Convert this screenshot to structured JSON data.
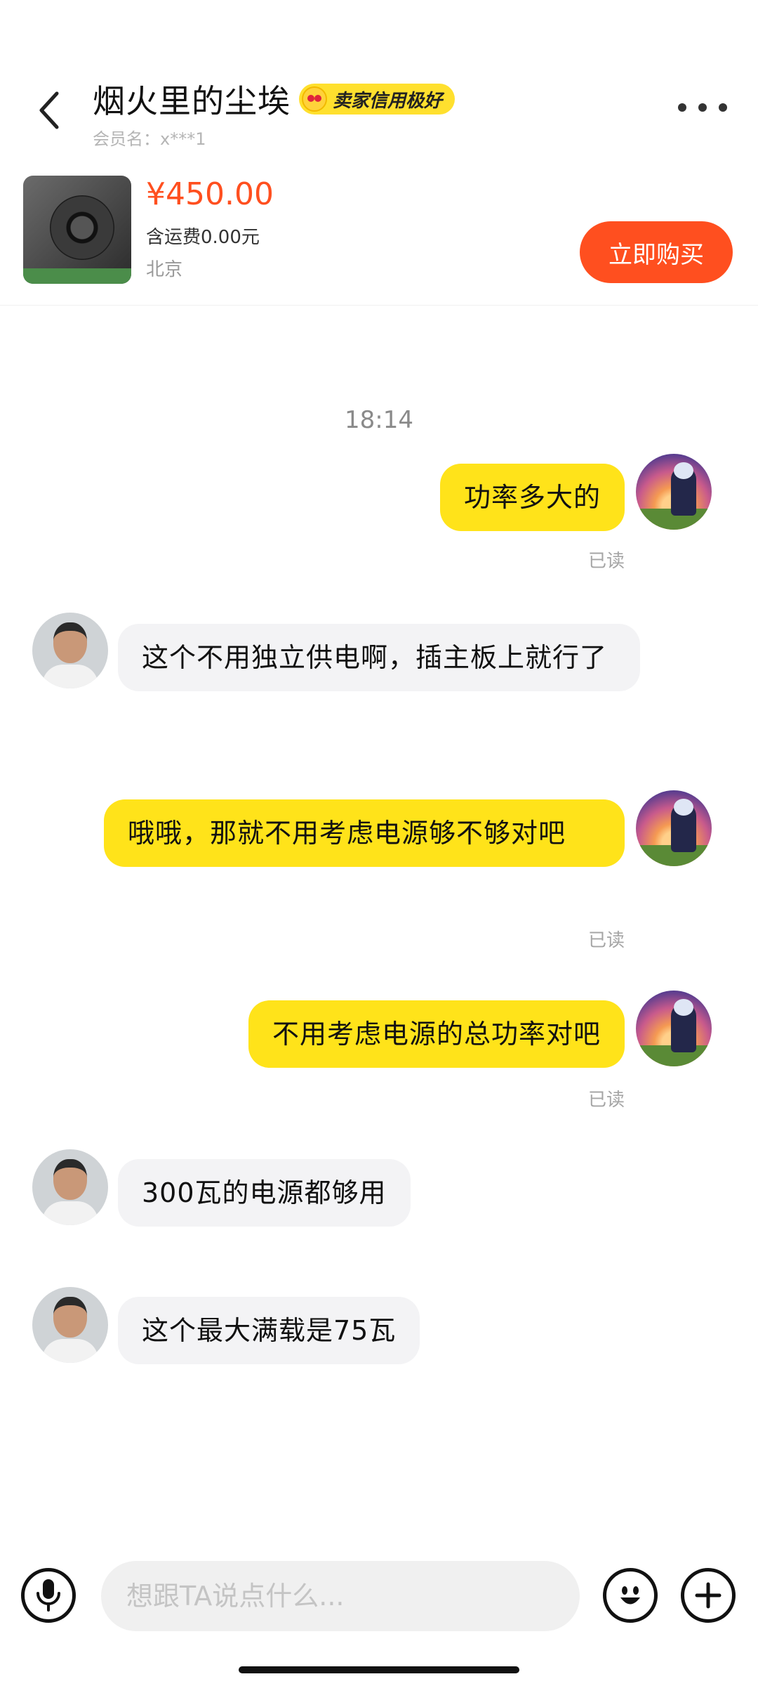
{
  "header": {
    "seller_name": "烟火里的尘埃",
    "credit_badge": "卖家信用极好",
    "member_label": "会员名：x***1",
    "back_icon": "chevron-left-icon",
    "more_icon": "more-dots-icon"
  },
  "product": {
    "price": "¥450.00",
    "shipping": "含运费0.00元",
    "location": "北京",
    "buy_label": "立即购买"
  },
  "chat": {
    "timestamp": "18:14",
    "messages": [
      {
        "side": "mine",
        "text": "功率多大的",
        "status": "已读"
      },
      {
        "side": "theirs",
        "text": "这个不用独立供电啊，插主板上就行了"
      },
      {
        "side": "mine",
        "text": "哦哦，那就不用考虑电源够不够对吧",
        "status": "已读"
      },
      {
        "side": "mine",
        "text": "不用考虑电源的总功率对吧",
        "status": "已读"
      },
      {
        "side": "theirs",
        "text": "300瓦的电源都够用"
      },
      {
        "side": "theirs",
        "text": "这个最大满载是75瓦"
      }
    ]
  },
  "input": {
    "placeholder": "想跟TA说点什么...",
    "mic_icon": "microphone-icon",
    "emoji_icon": "emoji-icon",
    "plus_icon": "plus-icon"
  },
  "colors": {
    "accent": "#ff4f1f",
    "my_bubble": "#ffe31a",
    "their_bubble": "#f3f3f5"
  }
}
